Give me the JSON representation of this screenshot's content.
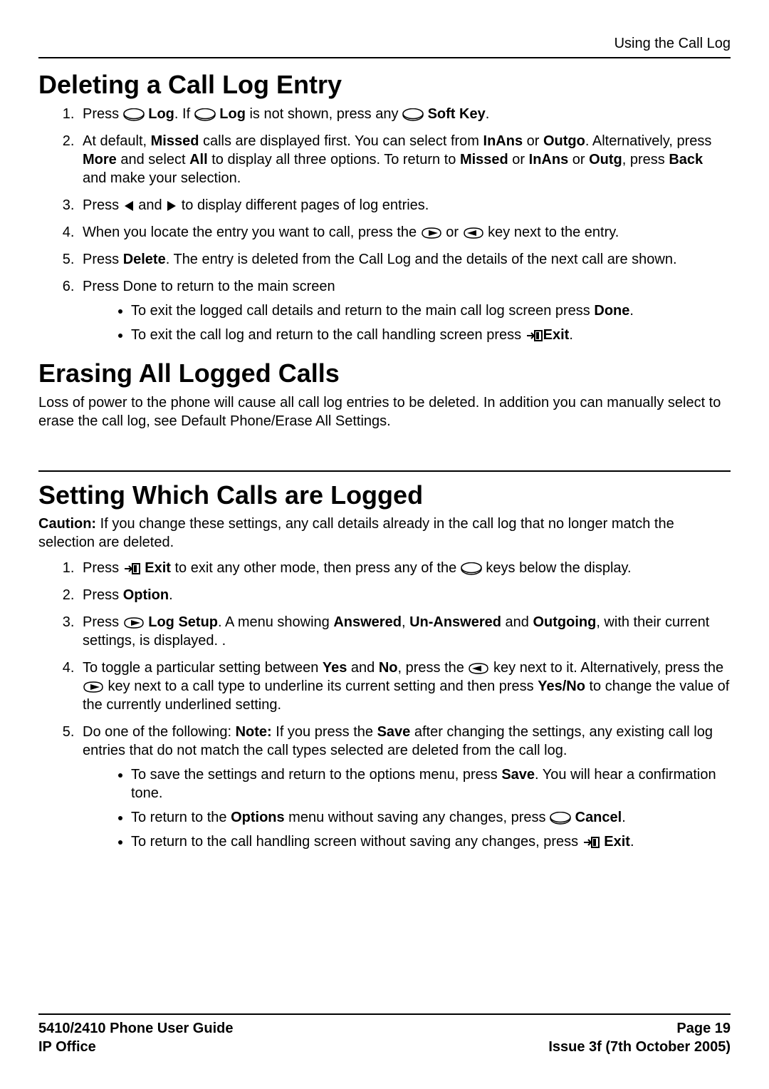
{
  "header": {
    "section_title": "Using the Call Log"
  },
  "s1": {
    "title": "Deleting a Call Log Entry",
    "i1a": "Press ",
    "i1b": " Log",
    "i1c": ". If ",
    "i1d": " Log",
    "i1e": " is not shown, press any ",
    "i1f": " Soft Key",
    "i1g": ".",
    "i2a": "At default, ",
    "i2b": "Missed",
    "i2c": " calls are displayed first. You can select from ",
    "i2d": "InAns",
    "i2e": " or ",
    "i2f": "Outgo",
    "i2g": ". Alternatively, press ",
    "i2h": "More",
    "i2i": " and select ",
    "i2j": "All",
    "i2k": " to display all three options. To return to ",
    "i2l": "Missed",
    "i2m": " or ",
    "i2n": "InAns",
    "i2o": " or ",
    "i2p": "Outg",
    "i2q": ", press ",
    "i2r": "Back",
    "i2s": " and make your selection.",
    "i3a": "Press ",
    "i3b": " and ",
    "i3c": " to display different pages of log entries.",
    "i4a": "When you locate the entry you want to call, press the ",
    "i4b": " or ",
    "i4c": " key next to the entry.",
    "i5a": "Press ",
    "i5b": "Delete",
    "i5c": ". The entry is deleted from the Call Log and the details of the next call are shown.",
    "i6a": "Press Done to return to the main screen",
    "b1a": "To exit the logged call details and return to the main call log screen press ",
    "b1b": "Done",
    "b1c": ".",
    "b2a": "To exit the call log and return to the call handling screen press ",
    "b2b": "Exit",
    "b2c": "."
  },
  "s2": {
    "title": "Erasing All Logged Calls",
    "p1": "Loss of power to the phone will cause all call log entries to be deleted. In addition you can manually select to erase the call log, see Default Phone/Erase All Settings."
  },
  "s3": {
    "title": "Setting Which Calls are Logged",
    "p1a": "Caution:",
    "p1b": " If you change these settings, any call details already in the call log that no longer match the selection are deleted.",
    "i1a": "Press ",
    "i1b": " Exit",
    "i1c": " to exit any other mode, then press any of the ",
    "i1d": " keys below the display.",
    "i2a": "Press ",
    "i2b": "Option",
    "i2c": ".",
    "i3a": "Press ",
    "i3b": " Log Setup",
    "i3c": ". A menu showing ",
    "i3d": "Answered",
    "i3e": ", ",
    "i3f": "Un-Answered",
    "i3g": " and ",
    "i3h": "Outgoing",
    "i3i": ", with their current settings, is displayed. .",
    "i4a": "To toggle a particular setting between ",
    "i4b": "Yes",
    "i4c": " and ",
    "i4d": "No",
    "i4e": ", press the ",
    "i4f": " key next to it. Alternatively, press the ",
    "i4g": " key next to a call type to underline its current setting and then press ",
    "i4h": "Yes/No",
    "i4i": " to change the value of the currently underlined setting.",
    "i5a": "Do one of the following: ",
    "i5b": "Note:",
    "i5c": "  If you press the ",
    "i5d": "Save",
    "i5e": " after changing the settings, any existing call log entries that do not match the call types selected are deleted from the call log.",
    "b1a": "To save the settings and return to the options menu, press ",
    "b1b": "Save",
    "b1c": ". You will hear a confirmation tone.",
    "b2a": "To return to the ",
    "b2b": "Options",
    "b2c": " menu without saving any changes, press ",
    "b2d": " Cancel",
    "b2e": ".",
    "b3a": "To return to the call handling screen without saving any changes, press ",
    "b3b": " Exit",
    "b3c": "."
  },
  "footer": {
    "left1": "5410/2410 Phone User Guide",
    "left2": "IP Office",
    "right1": "Page 19",
    "right2": "Issue 3f (7th October 2005)"
  }
}
